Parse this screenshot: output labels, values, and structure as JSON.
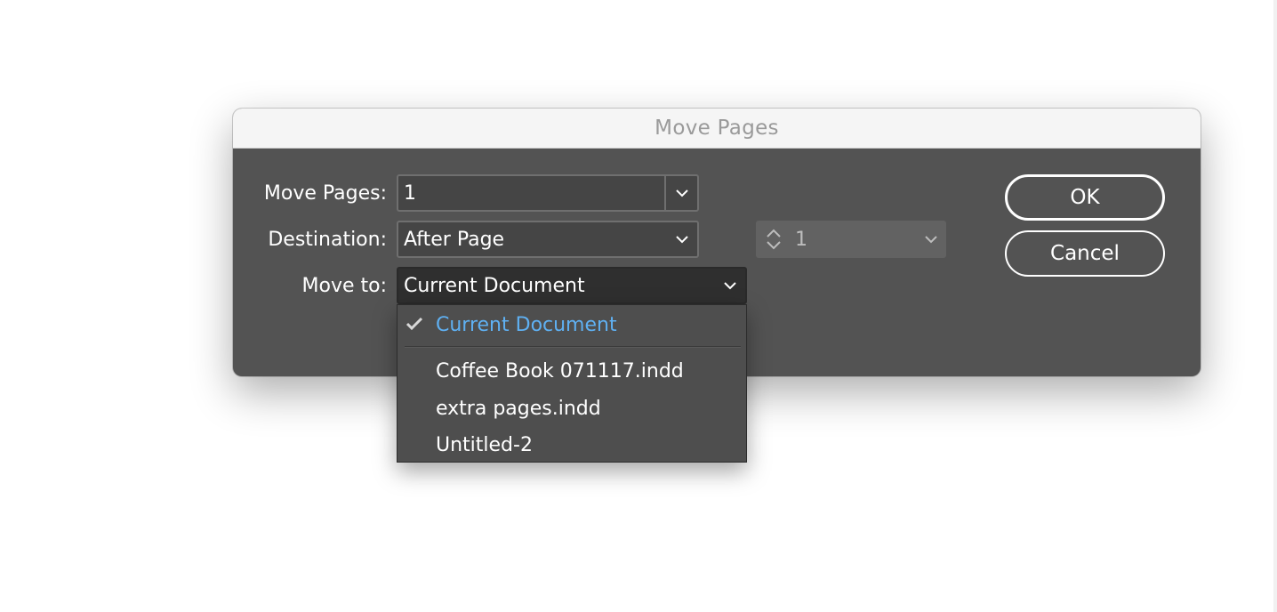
{
  "dialog": {
    "title": "Move Pages",
    "move_pages": {
      "label": "Move Pages:",
      "value": "1"
    },
    "destination": {
      "label": "Destination:",
      "value": "After Page",
      "page_value": "1"
    },
    "move_to": {
      "label": "Move to:",
      "value": "Current Document"
    },
    "ok_label": "OK",
    "cancel_label": "Cancel"
  },
  "menu": {
    "selected": "Current Document",
    "items": [
      "Coffee Book 071117.indd",
      "extra pages.indd",
      "Untitled-2"
    ]
  },
  "icons": {
    "chevron": "chevron-down-icon",
    "stepper": "stepper-icon",
    "check": "checkmark-icon"
  },
  "colors": {
    "dialog_bg": "#535353",
    "field_bg": "#454545",
    "selected_text": "#5fb0f2"
  }
}
